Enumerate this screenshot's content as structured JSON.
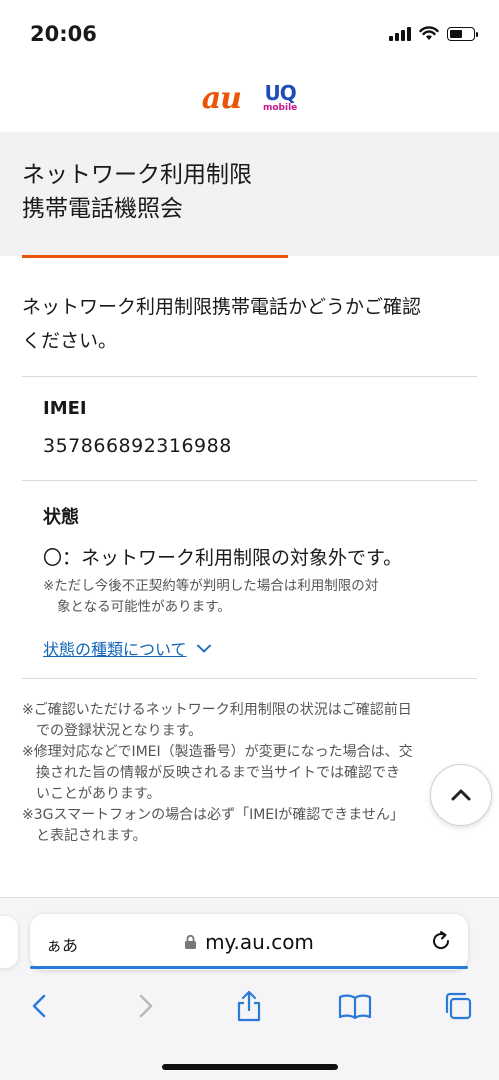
{
  "status_bar": {
    "time": "20:06",
    "battery_level": 0.55
  },
  "logos": {
    "au": "au",
    "uq": "UQ",
    "uq_sub": "mobile",
    "au_color": "#eb5505",
    "uq_color": "#1f4fb4",
    "mobile_color": "#c4168a"
  },
  "page": {
    "title_line1": "ネットワーク利用制限",
    "title_line2": "携帯電話機照会",
    "accent": "#eb5505",
    "intro_line1": "ネットワーク利用制限携帯電話かどうかご確認",
    "intro_line2": "ください。"
  },
  "imei": {
    "label": "IMEI",
    "value": "357866892316988"
  },
  "status": {
    "label": "状態",
    "result": "〇：ネットワーク利用制限の対象外です。",
    "note_line1": "※ただし今後不正契約等が判明した場合は利用制限の対",
    "note_line2": "象となる可能性があります。",
    "link_label": "状態の種類について"
  },
  "notes": [
    {
      "line1": "※ご確認いただけるネットワーク利用制限の状況はご確認前日",
      "line2": "での登録状況となります。"
    },
    {
      "line1": "※修理対応などでIMEI（製造番号）が変更になった場合は、交",
      "line2": "換された旨の情報が反映されるまで当サイトでは確認でき",
      "line3": "いことがあります。"
    },
    {
      "line1": "※3Gスマートフォンの場合は必ず「IMEIが確認できません」",
      "line2": "と表記されます。"
    }
  ],
  "browser": {
    "text_size_button": "ぁあ",
    "url": "my.au.com",
    "link_color": "#1366b9",
    "icons": [
      "back-icon",
      "forward-icon",
      "share-icon",
      "bookmarks-icon",
      "tabs-icon",
      "reload-icon",
      "lock-icon",
      "chevron-up-icon"
    ]
  }
}
